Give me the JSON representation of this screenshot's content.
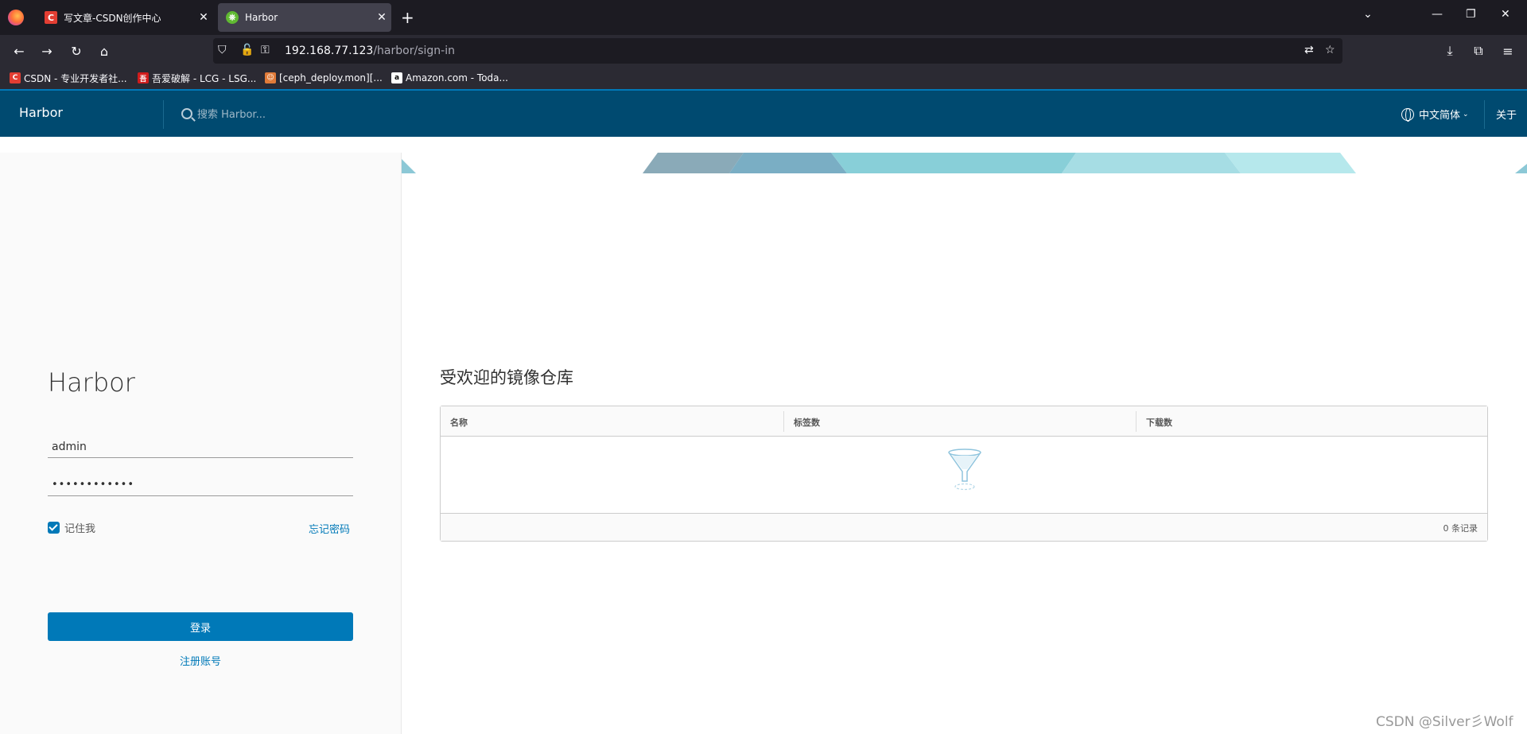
{
  "browser": {
    "tabs": [
      {
        "title": "写文章-CSDN创作中心",
        "icon": "csdn-favicon",
        "active": false
      },
      {
        "title": "Harbor",
        "icon": "harbor-favicon",
        "active": true
      }
    ],
    "url_host": "192.168.77.123",
    "url_path": "/harbor/sign-in",
    "bookmarks": [
      {
        "label": "CSDN - 专业开发者社...",
        "icon": "csdn-favicon",
        "icon_text": "C",
        "color": "#e33e33"
      },
      {
        "label": "吾爱破解 - LCG - LSG...",
        "icon": "52pojie-favicon",
        "icon_text": "吾",
        "color": "#d01c1c"
      },
      {
        "label": "[ceph_deploy.mon][...",
        "icon": "site-favicon",
        "icon_text": "☺",
        "color": "#e07b39"
      },
      {
        "label": "Amazon.com - Toda...",
        "icon": "amazon-favicon",
        "icon_text": "a",
        "color": "#ffffff"
      }
    ]
  },
  "header": {
    "brand": "Harbor",
    "search_placeholder": "搜索 Harbor...",
    "language": "中文简体",
    "about": "关于"
  },
  "login": {
    "title": "Harbor",
    "username": "admin",
    "password": "••••••••••••",
    "remember_label": "记住我",
    "remember_checked": true,
    "forgot_label": "忘记密码",
    "login_button": "登录",
    "signup_label": "注册账号"
  },
  "popular": {
    "title": "受欢迎的镜像仓库",
    "columns": [
      "名称",
      "标签数",
      "下载数"
    ],
    "rows": [],
    "footer_count": "0 条记录"
  },
  "watermark": "CSDN @Silver彡Wolf",
  "colors": {
    "header_bg": "#004a70",
    "accent": "#0079b8"
  }
}
